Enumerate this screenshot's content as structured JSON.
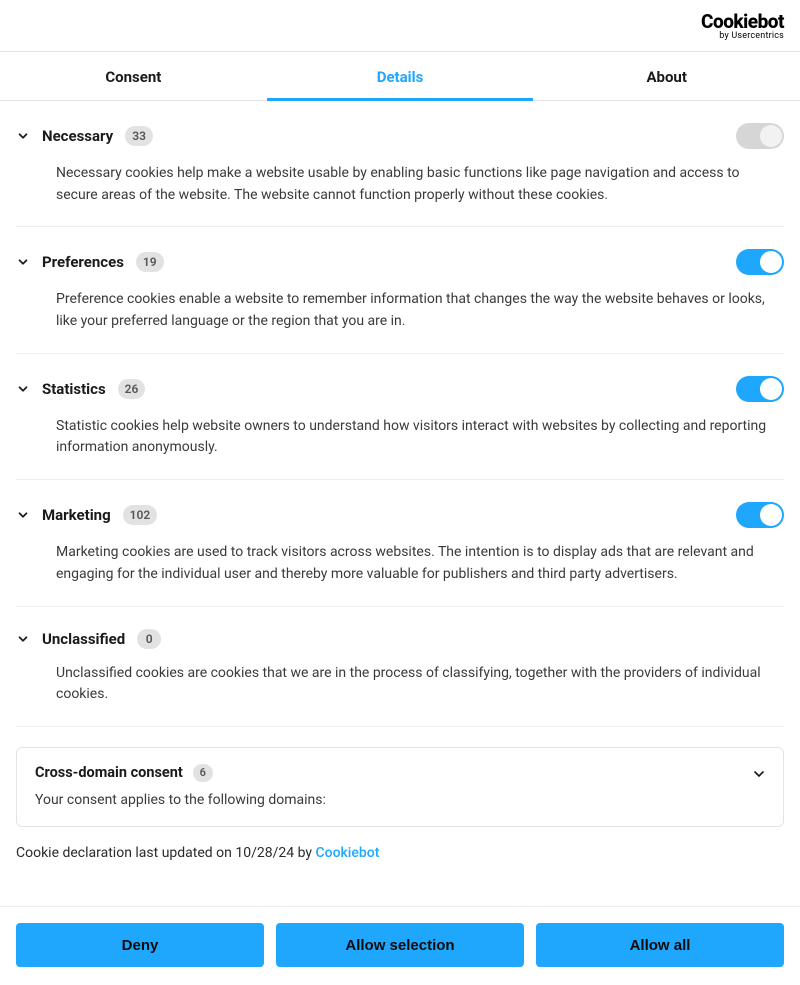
{
  "logo": {
    "main": "Cookiebot",
    "sub": "by Usercentrics"
  },
  "tabs": {
    "consent": "Consent",
    "details": "Details",
    "about": "About",
    "active": "details"
  },
  "categories": [
    {
      "key": "necessary",
      "title": "Necessary",
      "count": "33",
      "toggle": "disabled",
      "description": "Necessary cookies help make a website usable by enabling basic functions like page navigation and access to secure areas of the website. The website cannot function properly without these cookies."
    },
    {
      "key": "preferences",
      "title": "Preferences",
      "count": "19",
      "toggle": "on",
      "description": "Preference cookies enable a website to remember information that changes the way the website behaves or looks, like your preferred language or the region that you are in."
    },
    {
      "key": "statistics",
      "title": "Statistics",
      "count": "26",
      "toggle": "on",
      "description": "Statistic cookies help website owners to understand how visitors interact with websites by collecting and reporting information anonymously."
    },
    {
      "key": "marketing",
      "title": "Marketing",
      "count": "102",
      "toggle": "on",
      "description": "Marketing cookies are used to track visitors across websites. The intention is to display ads that are relevant and engaging for the individual user and thereby more valuable for publishers and third party advertisers."
    },
    {
      "key": "unclassified",
      "title": "Unclassified",
      "count": "0",
      "toggle": "none",
      "description": "Unclassified cookies are cookies that we are in the process of classifying, together with the providers of individual cookies."
    }
  ],
  "crossDomain": {
    "title": "Cross-domain consent",
    "count": "6",
    "description": "Your consent applies to the following domains:"
  },
  "declaration": {
    "prefix": "Cookie declaration last updated on ",
    "date": "10/28/24",
    "by": " by ",
    "provider": "Cookiebot"
  },
  "buttons": {
    "deny": "Deny",
    "allowSelection": "Allow selection",
    "allowAll": "Allow all"
  }
}
